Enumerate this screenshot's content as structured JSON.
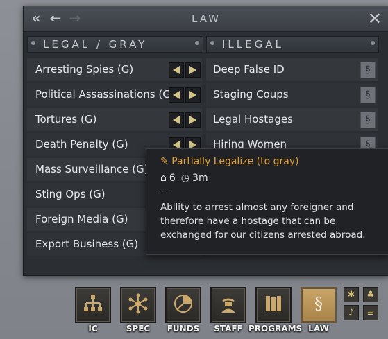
{
  "window": {
    "title": "LAW",
    "nav_back_all": "«",
    "nav_back": "←",
    "nav_forward": "→",
    "close": "✕"
  },
  "columns": {
    "legal_header": "LEGAL / GRAY",
    "illegal_header": "ILLEGAL"
  },
  "legal_items": [
    {
      "label": "Arresting Spies (G)"
    },
    {
      "label": "Political Assassinations (G)"
    },
    {
      "label": "Tortures (G)"
    },
    {
      "label": "Death Penalty (G)"
    },
    {
      "label": "Mass Surveillance (G)"
    },
    {
      "label": "Sting Ops (G)"
    },
    {
      "label": "Foreign Media (G)"
    },
    {
      "label": "Export Business (G)"
    }
  ],
  "illegal_items": [
    {
      "label": "Deep False ID"
    },
    {
      "label": "Staging Coups"
    },
    {
      "label": "Legal Hostages"
    },
    {
      "label": "Hiring Women"
    }
  ],
  "tooltip": {
    "title": "Partially Legalize (to gray)",
    "cost": "6",
    "time": "3m",
    "separator": "---",
    "description": "Ability to arrest almost any foreigner and therefore have a hostage that can be exchanged for our citizens arrested abroad."
  },
  "toolbar": {
    "buttons": [
      {
        "label": "IC",
        "icon": "hierarchy-icon"
      },
      {
        "label": "SPEC",
        "icon": "network-icon"
      },
      {
        "label": "FUNDS",
        "icon": "pie-chart-icon"
      },
      {
        "label": "STAFF",
        "icon": "agent-icon"
      },
      {
        "label": "PROGRAMS",
        "icon": "books-icon"
      },
      {
        "label": "LAW",
        "icon": "paragraph-icon"
      }
    ],
    "active": "LAW"
  },
  "colors": {
    "accent_orange": "#e3a23a",
    "arrow_yellow": "#d6c684",
    "law_active": "#c9a568"
  }
}
